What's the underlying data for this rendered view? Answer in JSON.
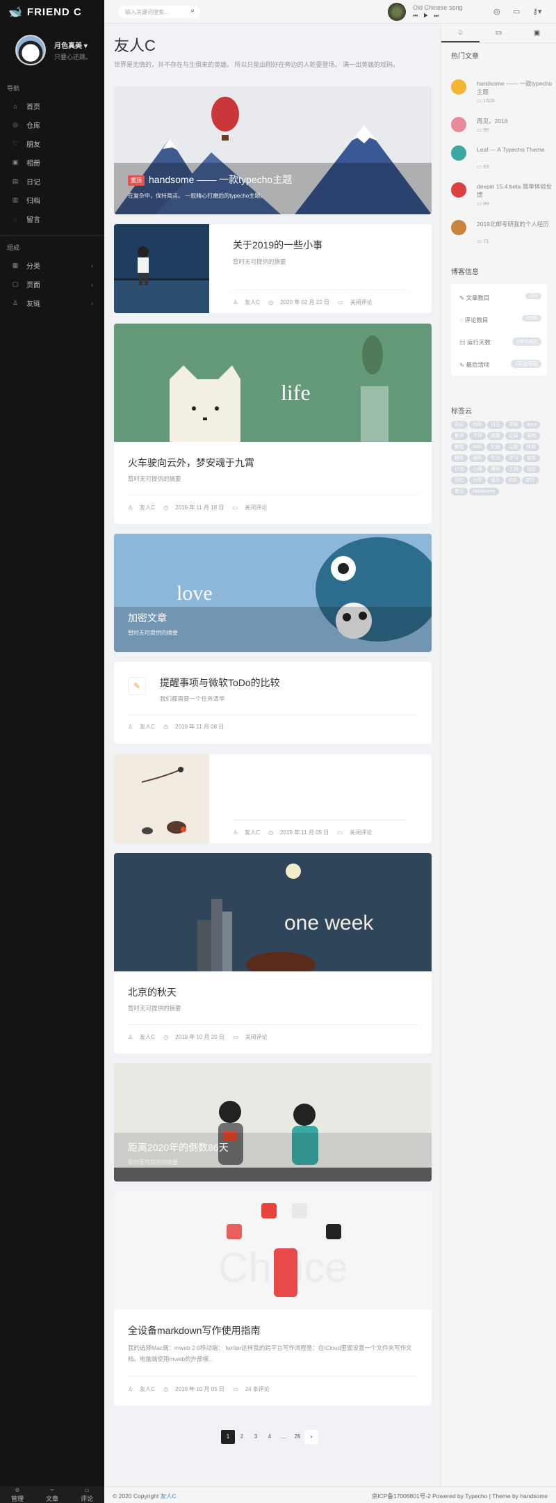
{
  "brand": {
    "name": "FRIEND C"
  },
  "user": {
    "name": "月色真美 ▾",
    "motto": "只要心还跳。"
  },
  "nav": {
    "section1": "导航",
    "items": [
      {
        "label": "首页",
        "icon": "home-icon"
      },
      {
        "label": "仓库",
        "icon": "github-icon"
      },
      {
        "label": "朋友",
        "icon": "heart-icon"
      },
      {
        "label": "相册",
        "icon": "image-icon"
      },
      {
        "label": "日记",
        "icon": "note-icon"
      },
      {
        "label": "归档",
        "icon": "archive-icon"
      },
      {
        "label": "留言",
        "icon": "message-icon"
      }
    ],
    "section2": "组成",
    "groups": [
      {
        "label": "分类",
        "icon": "grid-icon"
      },
      {
        "label": "页面",
        "icon": "file-icon"
      },
      {
        "label": "友链",
        "icon": "user-icon"
      }
    ]
  },
  "sidebar_footer": {
    "manage": "管理",
    "articles": "文章",
    "comments": "评论"
  },
  "header": {
    "search_placeholder": "输入关键词搜索...",
    "song": "Old Chinese song"
  },
  "page": {
    "title": "友人C",
    "description": "世界是无情的，并不存在与生俱来的英雄。 所以只能由刚好在旁边的人乾要登场。 满一出英雄的戏码。"
  },
  "posts": [
    {
      "tag": "置顶",
      "title": "handsome —— 一款typecho主题",
      "excerpt": "在复杂中，保持简洁。 一款精心打磨后的typecho主题。"
    },
    {
      "title": "关于2019的一些小事",
      "excerpt": "暂时无可提供的摘要",
      "author": "友人C",
      "date": "2020 年 02 月 22 日",
      "comments": "关闭评论"
    },
    {
      "title": "火车驶向云外，梦安魂于九霄",
      "excerpt": "暂时无可提供的摘要",
      "author": "友人C",
      "date": "2019 年 11 月 18 日",
      "comments": "关闭评论",
      "image_text": "life"
    },
    {
      "title": "加密文章",
      "excerpt": "暂时无可提供的摘要",
      "image_text": "love"
    },
    {
      "title": "提醒事项与微软ToDo的比较",
      "excerpt": "我们都需要一个任务清单",
      "author": "友人C",
      "date": "2019 年 11 月 08 日"
    },
    {
      "author": "友人C",
      "date": "2019 年 11 月 05 日",
      "comments": "关闭评论"
    },
    {
      "title": "北京的秋天",
      "excerpt": "暂时无可提供的摘要",
      "author": "友人C",
      "date": "2019 年 10 月 20 日",
      "comments": "关闭评论",
      "image_text": "one week"
    },
    {
      "title": "距离2020年的倒数86天",
      "excerpt": "暂时无可提供的摘要"
    },
    {
      "title": "全设备markdown写作使用指南",
      "excerpt": "我的选择Mac端：mweb 2.0移动端： Iwriter这样我的跨平台写作流程是：在iCloud里面设置一个文件夹写作文档。电脑端使用mweb的外部模...",
      "author": "友人C",
      "date": "2019 年 10 月 05 日",
      "comments": "24 条评论",
      "image_text": "Choice"
    }
  ],
  "pagination": [
    "1",
    "2",
    "3",
    "4",
    "...",
    "26",
    "›"
  ],
  "right": {
    "hot_title": "热门文章",
    "hot": [
      {
        "title": "handsome —— 一款typecho主题",
        "count": "1626",
        "color": "#f2b632"
      },
      {
        "title": "再见，2018",
        "count": "96",
        "color": "#e88a9a"
      },
      {
        "title": "Leaf — A Typecho Theme",
        "count": "93",
        "color": "#3aa7a0"
      },
      {
        "title": "deepin 15.4 beta 简单体验反馈",
        "count": "89",
        "color": "#d94040"
      },
      {
        "title": "2019北邮考研我的个人经历",
        "count": "71",
        "color": "#c8843c"
      }
    ],
    "stats_title": "博客信息",
    "stats": [
      {
        "label": "文章数目",
        "value": "115"
      },
      {
        "label": "评论数目",
        "value": "4898"
      },
      {
        "label": "运行天数",
        "value": "3年104天"
      },
      {
        "label": "最后活动",
        "value": "1天前活动"
      }
    ],
    "tags_title": "标签云",
    "tags": [
      "杂记",
      "代码",
      "日志",
      "学校",
      "linux",
      "影评",
      "书评",
      "随笔",
      "记录",
      "游戏",
      "教程",
      "mac",
      "文档",
      "主题",
      "体验",
      "插件",
      "源码",
      "生活",
      "学习",
      "软件",
      "计划",
      "心得",
      "博客",
      "工具",
      "设计",
      "回忆",
      "分享",
      "音乐",
      "iOS",
      "旅行",
      "笔记",
      "handsome"
    ]
  },
  "footer": {
    "copyright": "© 2020 Copyright",
    "site": "友人C",
    "right_text": "京ICP备17006801号-2 Powered by Typecho | Theme by handsome"
  }
}
